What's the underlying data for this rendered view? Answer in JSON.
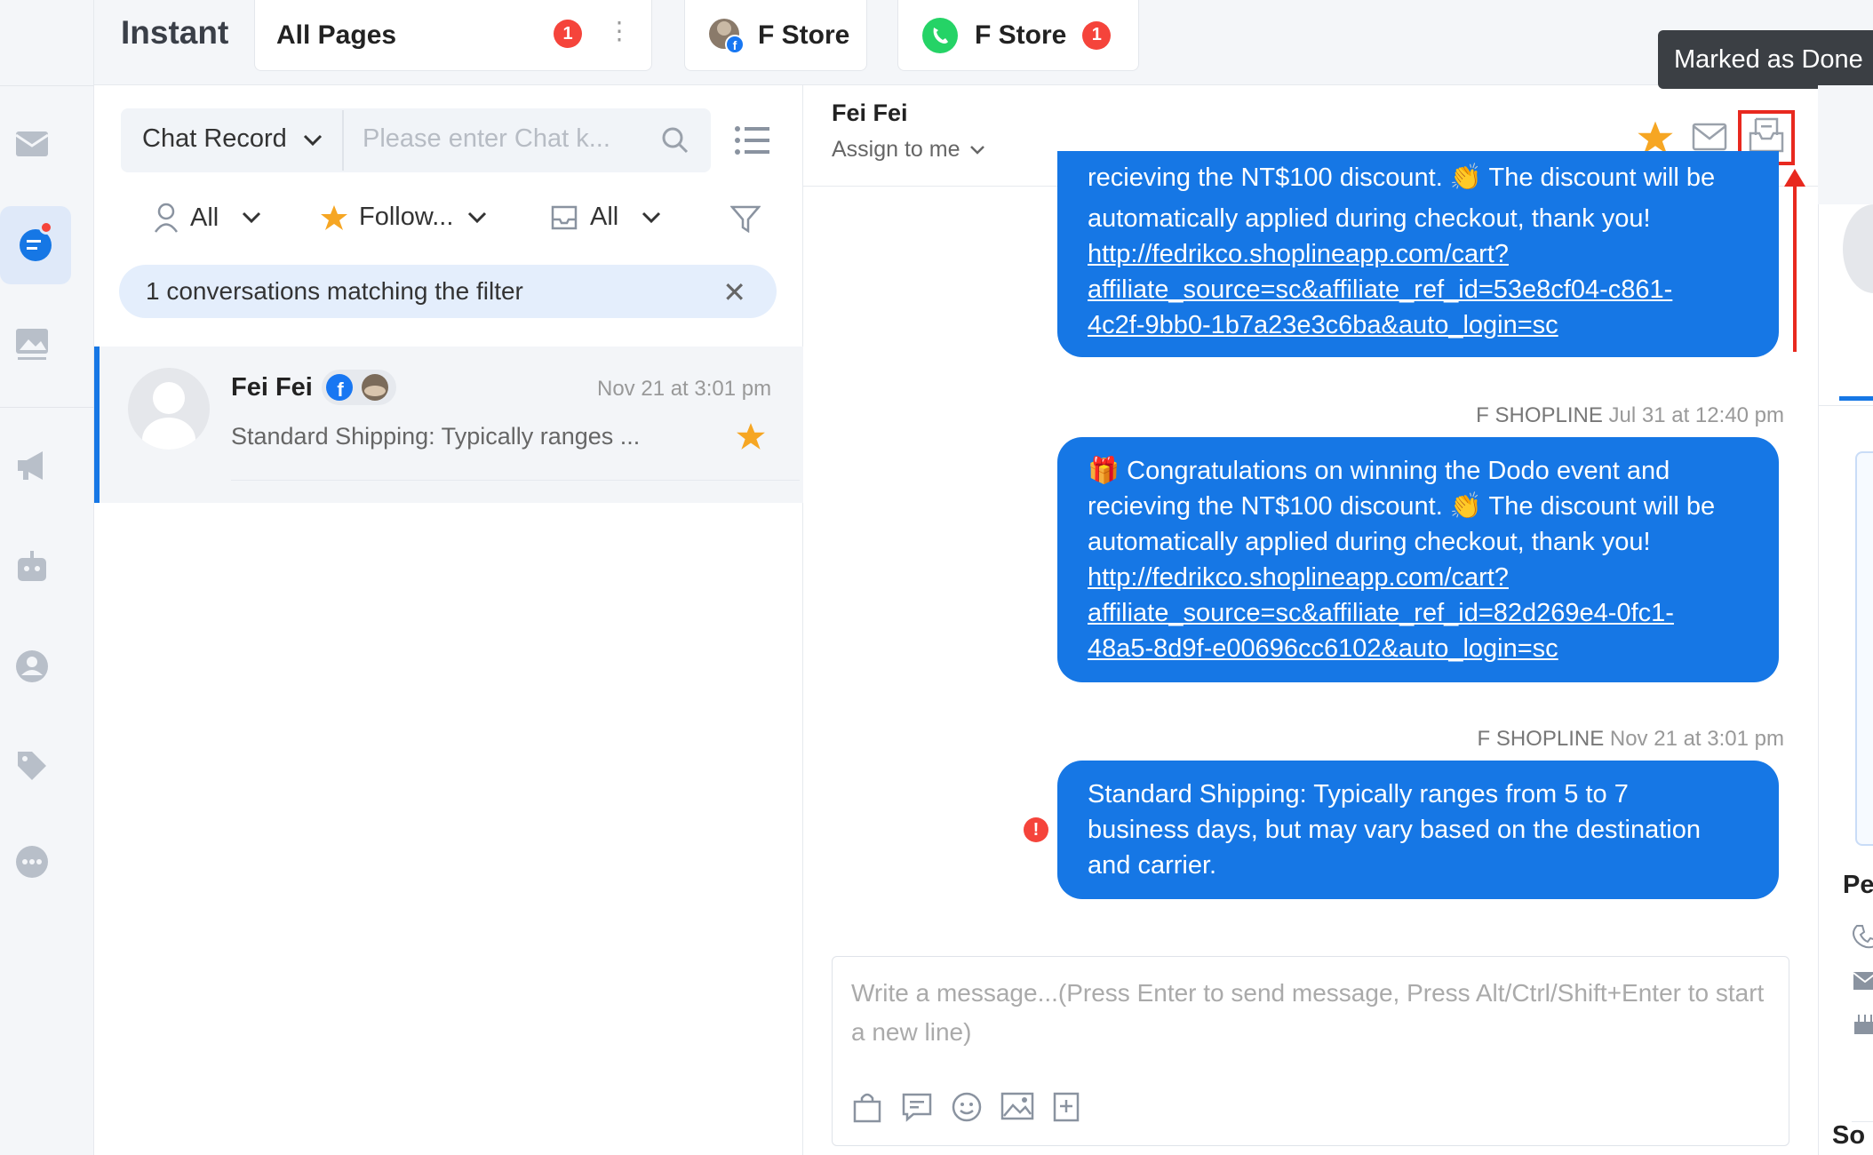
{
  "app": {
    "title": "Instant"
  },
  "tabs": [
    {
      "label": "All Pages",
      "badge": "1"
    },
    {
      "label": "F Store"
    },
    {
      "label": "F Store",
      "badge": "1"
    }
  ],
  "tooltip": "Marked as Done",
  "list": {
    "search_type": "Chat Record",
    "search_placeholder": "Please enter Chat k...",
    "filters": {
      "assignee": "All",
      "follow": "Follow...",
      "status": "All"
    },
    "match_text": "1 conversations matching the filter",
    "conversation": {
      "name": "Fei Fei",
      "time": "Nov 21 at 3:01 pm",
      "preview": "Standard Shipping: Typically ranges ..."
    }
  },
  "chat": {
    "name": "Fei Fei",
    "assign": "Assign to me",
    "messages": [
      {
        "cut_text": "recieving the NT$100 discount. 👏 The discount will be",
        "text": "automatically applied during checkout, thank you!",
        "link1": "http://fedrikco.shoplineapp.com/cart?",
        "link2": "affiliate_source=sc&affiliate_ref_id=53e8cf04-c861-",
        "link3": "4c2f-9bb0-1b7a23e3c6ba&auto_login=sc"
      },
      {
        "sender": "F SHOPLINE",
        "time": "Jul 31 at 12:40 pm",
        "line1": "🎁 Congratulations on winning the Dodo event and",
        "line2": "recieving the NT$100 discount. 👏 The discount will be",
        "line3": "automatically applied during checkout, thank you!",
        "link1": "http://fedrikco.shoplineapp.com/cart?",
        "link2": "affiliate_source=sc&affiliate_ref_id=82d269e4-0fc1-",
        "link3": "48a5-8d9f-e00696cc6102&auto_login=sc"
      },
      {
        "sender": "F SHOPLINE",
        "time": "Nov 21 at 3:01 pm",
        "line1": "Standard Shipping: Typically ranges from 5 to 7",
        "line2": "business days, but may vary based on the destination",
        "line3": "and carrier.",
        "error_mark": "!"
      }
    ],
    "composer_placeholder": "Write a message...(Press Enter to send message, Press Alt/Ctrl/Shift+Enter to start a new line)"
  },
  "right": {
    "label1": "Pe",
    "label2": "So"
  },
  "colors": {
    "accent": "#1677e5",
    "badge": "#f5443b",
    "star": "#f6a623",
    "highlight": "#e8291f"
  }
}
